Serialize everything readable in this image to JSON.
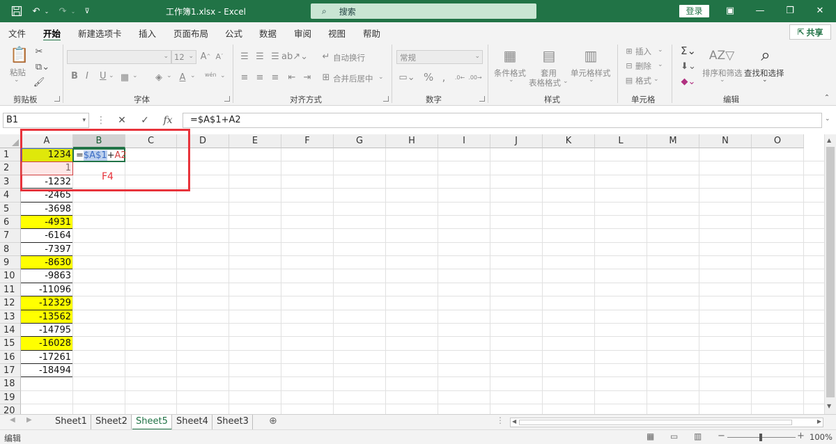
{
  "titlebar": {
    "title": "工作簿1.xlsx  -  Excel",
    "search_label": "搜索",
    "login_label": "登录"
  },
  "menu": {
    "items": [
      "文件",
      "开始",
      "新建选项卡",
      "插入",
      "页面布局",
      "公式",
      "数据",
      "审阅",
      "视图",
      "帮助"
    ],
    "active": "开始",
    "share_label": "共享"
  },
  "ribbon": {
    "clipboard": {
      "group": "剪贴板",
      "paste": "粘贴"
    },
    "font": {
      "group": "字体",
      "size": "12",
      "bold": "B",
      "italic": "I",
      "underline": "U",
      "wen": "wén"
    },
    "alignment": {
      "group": "对齐方式",
      "wrap": "自动换行",
      "merge": "合并后居中"
    },
    "number": {
      "group": "数字",
      "format": "常规",
      "percent": "%"
    },
    "styles": {
      "group": "样式",
      "conditional": "条件格式",
      "table_format_1": "套用",
      "table_format_2": "表格格式",
      "cell_styles": "单元格样式"
    },
    "cells": {
      "group": "单元格",
      "insert": "插入",
      "delete": "删除",
      "format": "格式"
    },
    "editing": {
      "group": "编辑",
      "sort_filter": "排序和筛选",
      "find_select": "查找和选择"
    }
  },
  "formula_bar": {
    "name_box": "B1",
    "fx": "fx",
    "formula": "=$A$1+A2"
  },
  "grid": {
    "columns": [
      "A",
      "B",
      "C",
      "D",
      "E",
      "F",
      "G",
      "H",
      "I",
      "J",
      "K",
      "L",
      "M",
      "N",
      "O"
    ],
    "selected_column": "B",
    "rows": [
      "1",
      "2",
      "3",
      "4",
      "5",
      "6",
      "7",
      "8",
      "9",
      "10",
      "11",
      "12",
      "13",
      "14",
      "15",
      "16",
      "17",
      "18",
      "19",
      "20"
    ],
    "colA_values": [
      "1234",
      "1",
      "-1232",
      "-2465",
      "-3698",
      "-4931",
      "-6164",
      "-7397",
      "-8630",
      "-9863",
      "-11096",
      "-12329",
      "-13562",
      "-14795",
      "-16028",
      "-17261",
      "-18494"
    ],
    "highlighted_rows": [
      1,
      6,
      9,
      12,
      13,
      15
    ],
    "edit_cell": {
      "eq": "=",
      "ref1": "$A$1",
      "plus": "+",
      "ref2": "A2"
    },
    "annotation": "F4",
    "highlight_color": "#ffff00"
  },
  "sheets": {
    "tabs": [
      "Sheet1",
      "Sheet2",
      "Sheet5",
      "Sheet4",
      "Sheet3"
    ],
    "active": "Sheet5"
  },
  "status": {
    "mode": "编辑",
    "zoom": "100%"
  },
  "colors": {
    "brand": "#217346",
    "annotation_red": "#e8333b"
  }
}
